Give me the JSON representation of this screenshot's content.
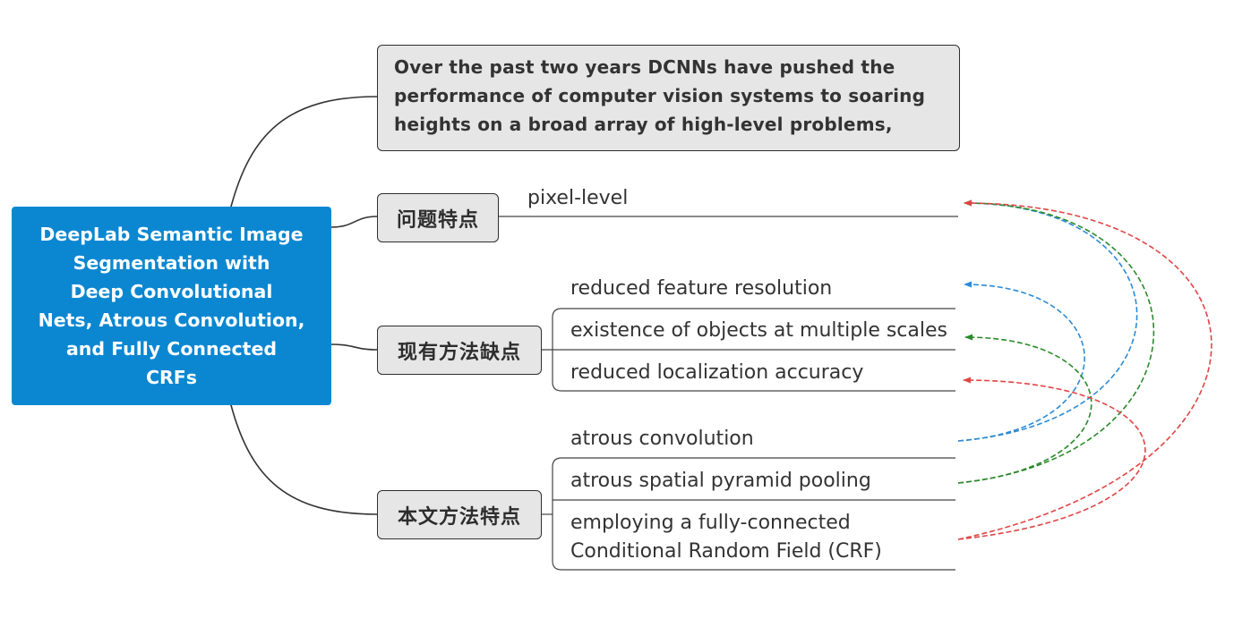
{
  "central_topic": {
    "lines": [
      "DeepLab Semantic Image",
      "Segmentation with",
      "Deep Convolutional",
      "Nets, Atrous Convolution,",
      "and Fully Connected",
      "CRFs"
    ]
  },
  "intro_topic": {
    "lines": [
      "Over the past two years DCNNs have pushed the",
      "performance of computer vision systems to soaring",
      "heights on a broad array of high-level problems,"
    ]
  },
  "branches": [
    {
      "label": "问题特点",
      "children": [
        {
          "lines": [
            "pixel-level"
          ]
        }
      ]
    },
    {
      "label": "现有方法缺点",
      "children": [
        {
          "lines": [
            "reduced feature resolution"
          ]
        },
        {
          "lines": [
            "existence of objects at multiple scales"
          ]
        },
        {
          "lines": [
            "reduced localization accuracy"
          ]
        }
      ]
    },
    {
      "label": "本文方法特点",
      "children": [
        {
          "lines": [
            "atrous convolution"
          ]
        },
        {
          "lines": [
            "atrous spatial pyramid pooling"
          ]
        },
        {
          "lines": [
            "employing a fully-connected",
            "Conditional Random Field (CRF)"
          ]
        }
      ]
    }
  ],
  "relationships": [
    {
      "from": {
        "branch": 2,
        "child": 0
      },
      "to": {
        "branch": 1,
        "child": 0
      },
      "color": "#2b8bd6"
    },
    {
      "from": {
        "branch": 2,
        "child": 0
      },
      "to": {
        "branch": 0,
        "child": 0
      },
      "color": "#2b8bd6"
    },
    {
      "from": {
        "branch": 2,
        "child": 1
      },
      "to": {
        "branch": 1,
        "child": 1
      },
      "color": "#2a8a2a"
    },
    {
      "from": {
        "branch": 2,
        "child": 1
      },
      "to": {
        "branch": 0,
        "child": 0
      },
      "color": "#2a8a2a"
    },
    {
      "from": {
        "branch": 2,
        "child": 2
      },
      "to": {
        "branch": 1,
        "child": 2
      },
      "color": "#e04545"
    },
    {
      "from": {
        "branch": 2,
        "child": 2
      },
      "to": {
        "branch": 0,
        "child": 0
      },
      "color": "#e04545"
    }
  ],
  "colors": {
    "central_fill": "#0b87d1",
    "central_text": "#ffffff",
    "topic_fill": "#e6e6e6"
  }
}
